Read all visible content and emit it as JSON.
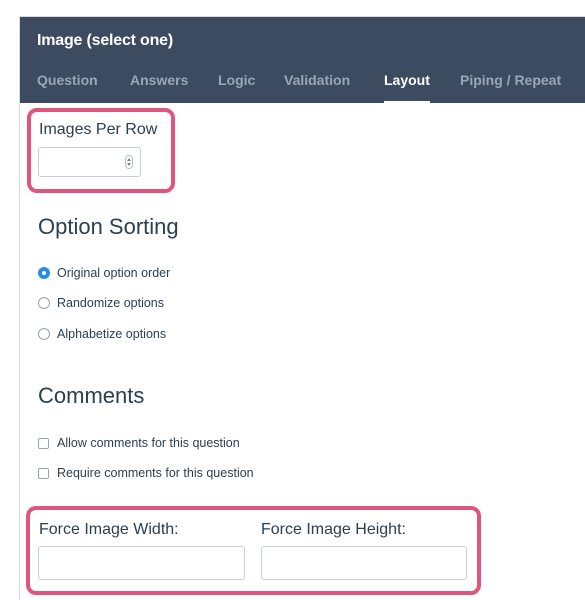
{
  "header": {
    "title": "Image (select one)",
    "tabs": [
      {
        "label": "Question",
        "active": false
      },
      {
        "label": "Answers",
        "active": false
      },
      {
        "label": "Logic",
        "active": false
      },
      {
        "label": "Validation",
        "active": false
      },
      {
        "label": "Layout",
        "active": true
      },
      {
        "label": "Piping / Repeat",
        "active": false
      }
    ]
  },
  "images_per_row": {
    "label": "Images Per Row",
    "value": ""
  },
  "option_sorting": {
    "title": "Option Sorting",
    "options": [
      {
        "label": "Original option order",
        "selected": true
      },
      {
        "label": "Randomize options",
        "selected": false
      },
      {
        "label": "Alphabetize options",
        "selected": false
      }
    ]
  },
  "comments": {
    "title": "Comments",
    "options": [
      {
        "label": "Allow comments for this question",
        "checked": false
      },
      {
        "label": "Require comments for this question",
        "checked": false
      }
    ]
  },
  "force_image": {
    "width_label": "Force Image Width:",
    "width_value": "",
    "height_label": "Force Image Height:",
    "height_value": ""
  },
  "colors": {
    "header_bg": "#3d4b60",
    "highlight": "#e0557e",
    "radio_selected": "#2a8ce3"
  }
}
